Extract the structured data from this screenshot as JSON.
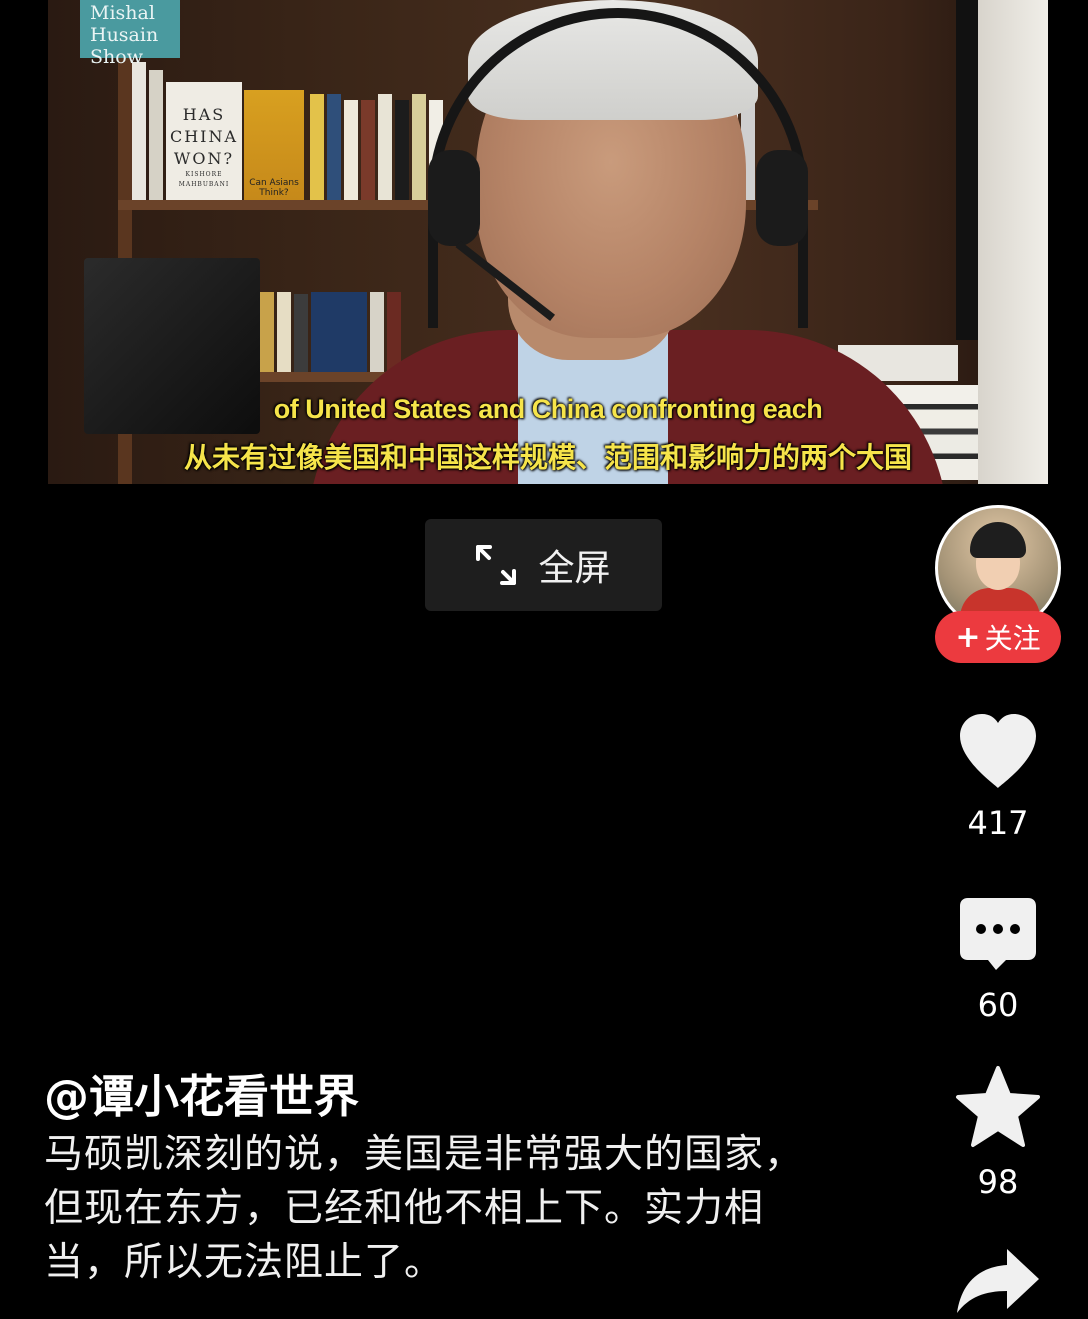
{
  "video": {
    "logo_text": "Mishal Husain Show",
    "book_title": "HAS CHINA WON?",
    "book_author": "KISHORE MAHBUBANI",
    "book2_title": "Can Asians Think?",
    "subtitle_en": "of United States and China confronting each",
    "subtitle_zh": "从未有过像美国和中国这样规模、范围和影响力的两个大国"
  },
  "controls": {
    "fullscreen_label": "全屏",
    "fullscreen_icon": "expand-icon"
  },
  "creator": {
    "follow_label": "关注",
    "follow_icon": "plus-icon"
  },
  "actions": {
    "likes": "417",
    "comments": "60",
    "favorites": "98"
  },
  "post": {
    "author": "@谭小花看世界",
    "description": "马硕凯深刻的说，美国是非常强大的国家，但现在东方，已经和他不相上下。实力相当，所以无法阻止了。"
  },
  "colors": {
    "background": "#000000",
    "follow_button": "#ec3a3f",
    "subtitle": "#f6e44a",
    "fullscreen_button": "#1e1e1e"
  }
}
